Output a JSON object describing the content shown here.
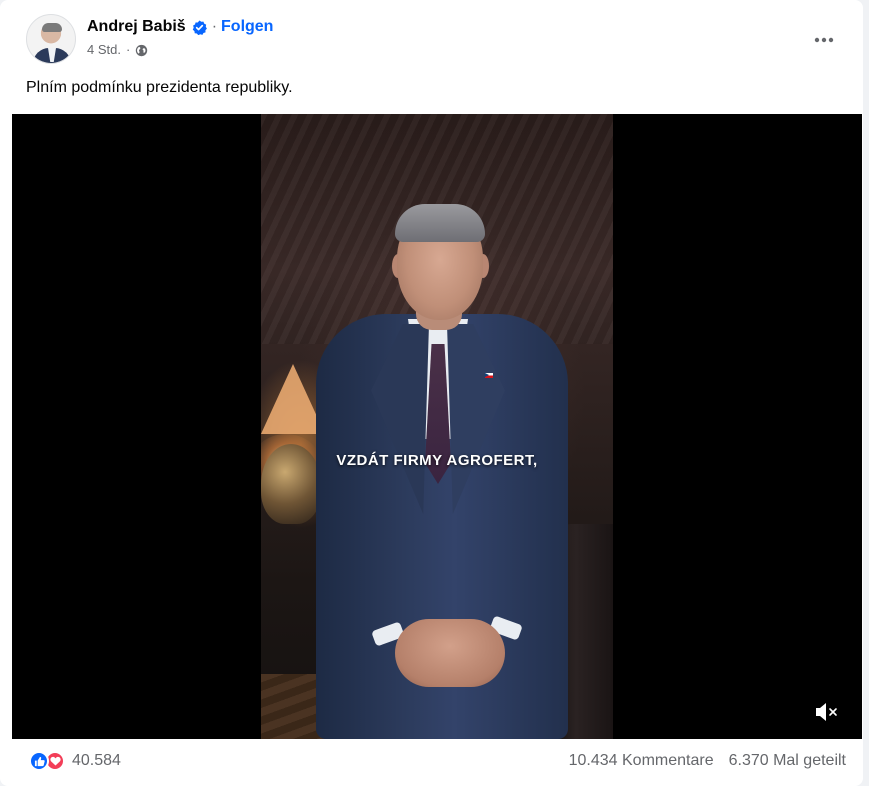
{
  "author": {
    "name": "Andrej Babiš",
    "separator": "·",
    "follow_label": "Folgen",
    "verified_icon": "verified-badge-icon"
  },
  "meta": {
    "time": "4 Std.",
    "separator": "·",
    "audience_icon": "globe-icon"
  },
  "post": {
    "text": "Plním podmínku prezidenta republiky."
  },
  "video": {
    "caption": "VZDÁT FIRMY AGROFERT,",
    "muted": true,
    "mute_icon": "speaker-muted-icon"
  },
  "footer": {
    "reaction_count": "40.584",
    "comments": "10.434 Kommentare",
    "shares": "6.370 Mal geteilt",
    "reactions": [
      "like",
      "love"
    ]
  },
  "colors": {
    "accent": "#0866ff",
    "love": "#f33e58",
    "secondary_text": "#65676b",
    "primary_text": "#050505"
  }
}
